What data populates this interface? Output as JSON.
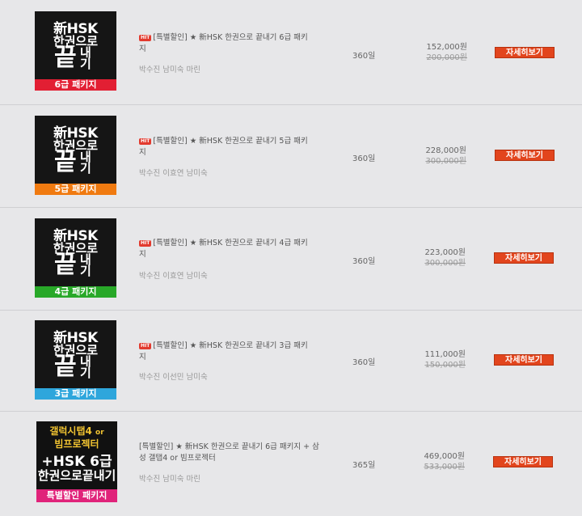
{
  "products": [
    {
      "thumb": {
        "line1": "新HSK",
        "line2": "한권으로",
        "big": "끝",
        "side1": "내",
        "side2": "기",
        "band": "6급 패키지",
        "band_color": "#e21f33"
      },
      "hit": "HIT",
      "title": "[특별할인] ★ 新HSK 한권으로 끝내기 6급 패키지",
      "authors": "박수진 남미숙 마린",
      "days": "360일",
      "price": "152,000원",
      "original_price": "200,000원",
      "button": "자세히보기"
    },
    {
      "thumb": {
        "line1": "新HSK",
        "line2": "한권으로",
        "big": "끝",
        "side1": "내",
        "side2": "기",
        "band": "5급 패키지",
        "band_color": "#f07a10"
      },
      "hit": "HIT",
      "title": "[특별할인] ★ 新HSK 한권으로 끝내기 5급 패키지",
      "authors": "박수진 이효연 남미숙",
      "days": "360일",
      "price": "228,000원",
      "original_price": "300,000원",
      "button": "자세히보기"
    },
    {
      "thumb": {
        "line1": "新HSK",
        "line2": "한권으로",
        "big": "끝",
        "side1": "내",
        "side2": "기",
        "band": "4급 패키지",
        "band_color": "#28a828"
      },
      "hit": "HIT",
      "title": "[특별할인] ★ 新HSK 한권으로 끝내기 4급 패키지",
      "authors": "박수진 이효연 남미숙",
      "days": "360일",
      "price": "223,000원",
      "original_price": "300,000원",
      "button": "자세히보기"
    },
    {
      "thumb": {
        "line1": "新HSK",
        "line2": "한권으로",
        "big": "끝",
        "side1": "내",
        "side2": "기",
        "band": "3급 패키지",
        "band_color": "#2ea6dc"
      },
      "hit": "HIT",
      "title": "[특별할인] ★ 新HSK 한권으로 끝내기 3급 패키지",
      "authors": "박수진 이선민 남미숙",
      "days": "360일",
      "price": "111,000원",
      "original_price": "150,000원",
      "button": "자세히보기"
    },
    {
      "thumb": {
        "line1": "갤럭시탭4",
        "line1_small": "or",
        "line2": "빔프로젝터",
        "line3": "+HSK 6급",
        "line4": "한권으로끝내기",
        "band": "특별할인 패키지",
        "band_color": "#e0237a"
      },
      "title": "[특별할인] ★ 新HSK 한권으로 끝내기 6급 패키지 + 삼성 갤탭4 or 빔프로젝터",
      "authors": "박수진 남미숙 마린",
      "days": "365일",
      "price": "469,000원",
      "original_price": "533,000원",
      "button": "자세히보기"
    }
  ]
}
